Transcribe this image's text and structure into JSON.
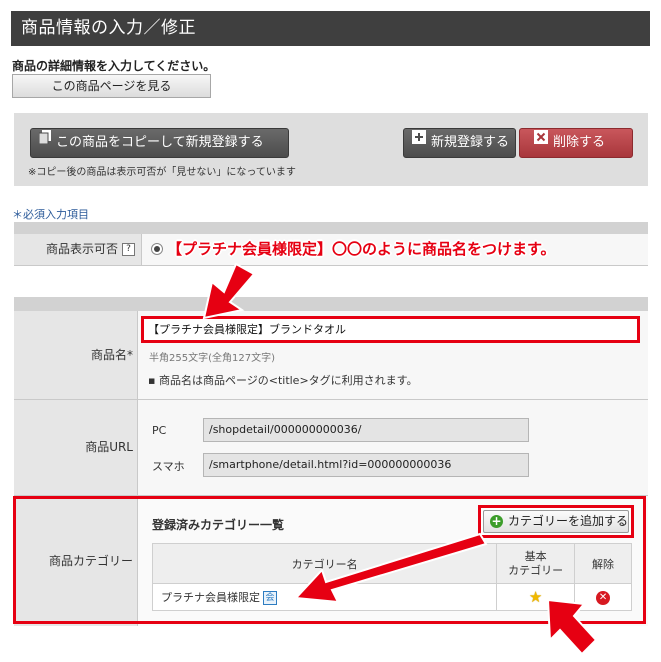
{
  "header": {
    "title": "商品情報の入力／修正"
  },
  "intro": {
    "description": "商品の詳細情報を入力してください。",
    "view_page_button": "この商品ページを見る"
  },
  "actions": {
    "copy_button": "この商品をコピーして新規登録する",
    "new_button": "新規登録する",
    "delete_button": "削除する",
    "copy_note": "※コピー後の商品は表示可否が「見せない」になっています"
  },
  "required_note": "＊必須入力項目",
  "visibility": {
    "label": "商品表示可否",
    "help": "?"
  },
  "annotation": "【プラチナ会員様限定】〇〇のように商品名をつけます。",
  "product_name": {
    "label": "商品名*",
    "value": "【プラチナ会員様限定】ブランドタオル",
    "limit": "半角255文字(全角127文字)",
    "note": "商品名は商品ページの<title>タグに利用されます。"
  },
  "product_url": {
    "label": "商品URL",
    "pc_label": "PC",
    "pc_value": "/shopdetail/000000000036/",
    "sp_label": "スマホ",
    "sp_value": "/smartphone/detail.html?id=000000000036"
  },
  "category": {
    "label": "商品カテゴリー",
    "list_title": "登録済みカテゴリー一覧",
    "add_button": "カテゴリーを追加する",
    "columns": {
      "name": "カテゴリー名",
      "basic": "基本\nカテゴリー",
      "remove": "解除"
    },
    "rows": [
      {
        "name": "プラチナ会員様限定",
        "badge": "会"
      }
    ]
  },
  "colors": {
    "accent_red": "#e60012",
    "title_bar": "#3f3f3f",
    "delete_red": "#b94146"
  }
}
